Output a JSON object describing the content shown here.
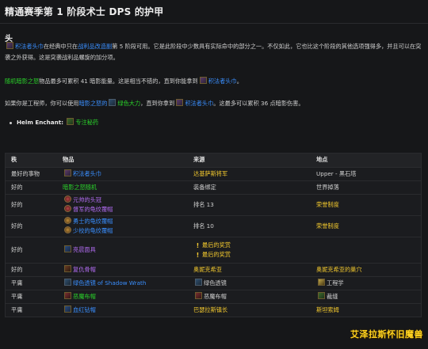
{
  "page": {
    "title": "精通赛季第 1 阶段术士 DPS 的护甲",
    "section_head": "头"
  },
  "p1": {
    "item": "积法者头巾",
    "t1": "在经典中只在",
    "link1": "战利品改造副",
    "t2": "第 5 阶段可用。它是此阶段中少数具有实际命中的部分之一。不仅如此，它也比这个阶段的其他选项强得多，并且可以在突袭之外获得。这是突袭战利品螺旋的加分项。"
  },
  "p2": {
    "item": "随机暗影之怒",
    "t1": "物品最多可累积 41 暗影能量。这是相当不错的，直到你能拿到",
    "item2": "积法者头巾",
    "t2": "。"
  },
  "p3": {
    "t1": "如果你是工程师，你可以使用",
    "link1": "暗影之怒的",
    "link2": "绿色大力",
    "t2": "，直到你拿到",
    "item": "积法者头巾",
    "t3": "。这最多可以累积 36 点暗影伤害。"
  },
  "enchant": {
    "label": "Helm Enchant:",
    "value": "专注秘药"
  },
  "table": {
    "headers": [
      "秩",
      "物品",
      "来源",
      "地点"
    ],
    "rows": [
      {
        "rank": "最好的事物",
        "items": [
          {
            "name": "积法者头巾",
            "q": "rare",
            "icon": "sq"
          }
        ],
        "source": [
          {
            "text": "达基萨斯将军",
            "icon": ""
          }
        ],
        "source_color": "gold",
        "loc": "Upper - 黑石塔",
        "loc_color": "plain"
      },
      {
        "rank": "好的",
        "items": [
          {
            "name": "暗影之怒随机",
            "q": "uncommon",
            "icon": ""
          }
        ],
        "source": [
          {
            "text": "装备绑定",
            "icon": ""
          }
        ],
        "source_color": "plain",
        "loc": "世界掉落",
        "loc_color": "plain"
      },
      {
        "rank": "好的",
        "items": [
          {
            "name": "元帅的头冠",
            "q": "epic",
            "icon": "circ"
          },
          {
            "name": "督军的龟纹覆帽",
            "q": "epic",
            "icon": "circ"
          }
        ],
        "source": [
          {
            "text": "排名 13",
            "icon": ""
          }
        ],
        "source_color": "plain",
        "loc": "荣誉制度",
        "loc_color": "gold"
      },
      {
        "rank": "好的",
        "items": [
          {
            "name": "勇士的龟纹覆帽",
            "q": "rare",
            "icon": "circ2"
          },
          {
            "name": "少校的龟纹覆帽",
            "q": "rare",
            "icon": "circ2"
          }
        ],
        "source": [
          {
            "text": "排名 10",
            "icon": ""
          }
        ],
        "source_color": "plain",
        "loc": "荣誉制度",
        "loc_color": "gold"
      },
      {
        "rank": "好的",
        "items": [
          {
            "name": "亮晨面具",
            "q": "epic",
            "icon": "sq2"
          }
        ],
        "source": [
          {
            "text": "最后的奖赏",
            "icon": "excl"
          },
          {
            "text": "最后的奖赏",
            "icon": "excl"
          }
        ],
        "source_color": "plain",
        "loc": "",
        "loc_color": "plain"
      },
      {
        "rank": "好的",
        "items": [
          {
            "name": "复仇骨帽",
            "q": "epic",
            "icon": "sq3"
          }
        ],
        "source": [
          {
            "text": "奥妮克希亚",
            "icon": ""
          }
        ],
        "source_color": "gold",
        "loc": "奥妮克希亚的巢穴",
        "loc_color": "gold"
      },
      {
        "rank": "平庸",
        "items": [
          {
            "name": "绿色透镜 of Shadow Wrath",
            "q": "rare",
            "icon": "sq6"
          }
        ],
        "source": [
          {
            "text": "绿色透镜",
            "icon": "sq6"
          }
        ],
        "source_color": "plain",
        "loc": "工程学",
        "loc_color": "plain",
        "loc_icon": "sword"
      },
      {
        "rank": "平庸",
        "items": [
          {
            "name": "恶魔布帽",
            "q": "uncommon",
            "icon": "sq5"
          }
        ],
        "source": [
          {
            "text": "恶魔布帽",
            "icon": "sq5"
          }
        ],
        "source_color": "plain",
        "loc": "裁缝",
        "loc_color": "plain",
        "loc_icon": "sq4"
      },
      {
        "rank": "平庸",
        "items": [
          {
            "name": "血红钻帽",
            "q": "rare",
            "icon": "sq2"
          }
        ],
        "source": [
          {
            "text": "巴瑟拉斯镇长",
            "icon": ""
          }
        ],
        "source_color": "gold",
        "loc": "斯坦索姆",
        "loc_color": "gold"
      }
    ]
  },
  "watermark": "艾泽拉斯怀旧魔兽"
}
